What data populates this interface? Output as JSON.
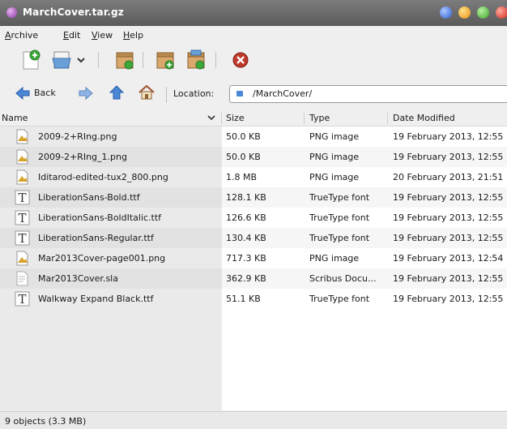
{
  "window": {
    "title": "MarchCover.tar.gz"
  },
  "menu": [
    "Archive",
    "Edit",
    "View",
    "Help"
  ],
  "toolbar": {
    "icons": [
      "new-archive-icon",
      "open-archive-icon",
      "dropdown-arrow-icon",
      "extract-icon",
      "add-files-icon",
      "add-folder-icon",
      "stop-icon"
    ]
  },
  "location_bar": {
    "back_label": "Back",
    "location_label": "Location:",
    "path": "/MarchCover/"
  },
  "columns": [
    "Name",
    "Size",
    "Type",
    "Date Modified"
  ],
  "files": [
    {
      "name": "2009-2+RIng.png",
      "size": "50.0 KB",
      "type": "PNG image",
      "modified": "19 February 2013, 12:55",
      "icon": "image-file-icon"
    },
    {
      "name": "2009-2+RIng_1.png",
      "size": "50.0 KB",
      "type": "PNG image",
      "modified": "19 February 2013, 12:55",
      "icon": "image-file-icon"
    },
    {
      "name": "Iditarod-edited-tux2_800.png",
      "size": "1.8 MB",
      "type": "PNG image",
      "modified": "20 February 2013, 21:51",
      "icon": "image-file-icon"
    },
    {
      "name": "LiberationSans-Bold.ttf",
      "size": "128.1 KB",
      "type": "TrueType font",
      "modified": "19 February 2013, 12:55",
      "icon": "font-file-icon"
    },
    {
      "name": "LiberationSans-BoldItalic.ttf",
      "size": "126.6 KB",
      "type": "TrueType font",
      "modified": "19 February 2013, 12:55",
      "icon": "font-file-icon"
    },
    {
      "name": "LiberationSans-Regular.ttf",
      "size": "130.4 KB",
      "type": "TrueType font",
      "modified": "19 February 2013, 12:55",
      "icon": "font-file-icon"
    },
    {
      "name": "Mar2013Cover-page001.png",
      "size": "717.3 KB",
      "type": "PNG image",
      "modified": "19 February 2013, 12:54",
      "icon": "image-file-icon"
    },
    {
      "name": "Mar2013Cover.sla",
      "size": "362.9 KB",
      "type": "Scribus Docu...",
      "modified": "19 February 2013, 12:55",
      "icon": "document-file-icon"
    },
    {
      "name": "Walkway Expand Black.ttf",
      "size": "51.1 KB",
      "type": "TrueType font",
      "modified": "19 February 2013, 12:55",
      "icon": "font-file-icon"
    }
  ],
  "status": "9 objects (3.3 MB)",
  "colors": {
    "titlebar": "#6b6b6b",
    "close": "#e03a2a",
    "maximize": "#4fbf3a",
    "minimize": "#f0a020",
    "blue_button": "#3a6fd8"
  }
}
